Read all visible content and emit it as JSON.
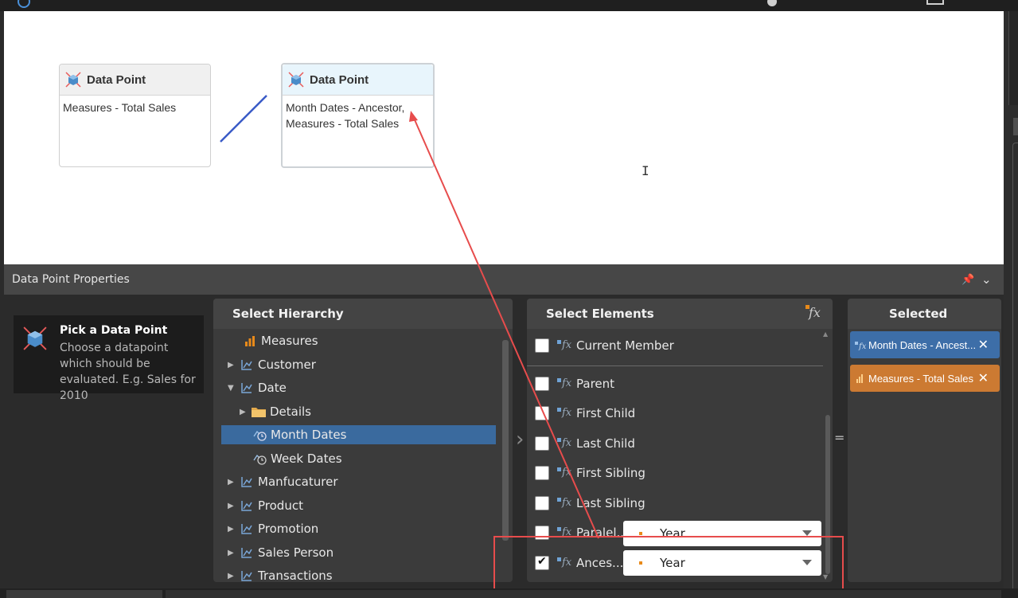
{
  "canvas": {
    "cards": [
      {
        "title": "Data Point",
        "body": "Measures - Total Sales"
      },
      {
        "title": "Data Point",
        "body_line1": "Month Dates - Ancestor,",
        "body_line2": "Measures - Total Sales"
      }
    ]
  },
  "panel": {
    "title": "Data Point Properties",
    "pick": {
      "title": "Pick a Data Point",
      "description": "Choose a datapoint which should be evaluated. E.g. Sales for 2010"
    },
    "hierarchy": {
      "title": "Select Hierarchy",
      "items": [
        {
          "label": "Measures",
          "icon": "bar-chart-icon",
          "expanded": null
        },
        {
          "label": "Customer",
          "icon": "hierarchy-icon",
          "expanded": false
        },
        {
          "label": "Date",
          "icon": "hierarchy-icon",
          "expanded": true
        },
        {
          "label": "Details",
          "icon": "folder-icon",
          "expanded": false
        },
        {
          "label": "Month Dates",
          "icon": "time-level-icon",
          "selected": true
        },
        {
          "label": "Week Dates",
          "icon": "time-level-icon"
        },
        {
          "label": "Manfucaturer",
          "icon": "hierarchy-icon",
          "expanded": false
        },
        {
          "label": "Product",
          "icon": "hierarchy-icon",
          "expanded": false
        },
        {
          "label": "Promotion",
          "icon": "hierarchy-icon",
          "expanded": false
        },
        {
          "label": "Sales Person",
          "icon": "hierarchy-icon",
          "expanded": false
        },
        {
          "label": "Transactions",
          "icon": "hierarchy-icon",
          "expanded": false
        }
      ]
    },
    "elements": {
      "title": "Select Elements",
      "items": [
        {
          "label": "Current Member",
          "checked": false
        },
        {
          "label": "Parent",
          "checked": false
        },
        {
          "label": "First Child",
          "checked": false
        },
        {
          "label": "Last Child",
          "checked": false
        },
        {
          "label": "First Sibling",
          "checked": false
        },
        {
          "label": "Last Sibling",
          "checked": false
        },
        {
          "label": "Paralel...",
          "checked": false,
          "dropdown": "Year"
        },
        {
          "label": "Ances...",
          "checked": true,
          "dropdown": "Year"
        }
      ]
    },
    "selected": {
      "title": "Selected",
      "chips": [
        {
          "label": "Month Dates - Ancest...",
          "color": "#3d6ea8"
        },
        {
          "label": "Measures - Total Sales",
          "color": "#cc7a32"
        }
      ]
    }
  },
  "colors": {
    "accent_blue": "#3a6a9e",
    "accent_orange": "#e88a1a",
    "annotation_red": "#e74c4c",
    "connector_blue": "#3a5bc7"
  }
}
